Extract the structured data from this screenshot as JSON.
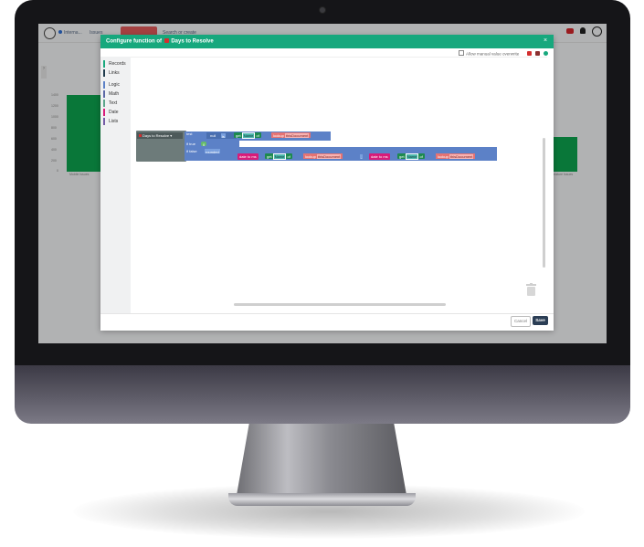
{
  "app": {
    "breadcrumbs": [
      "Interna...",
      "Issues"
    ],
    "active_tab": "",
    "search_hint": "Search or create",
    "chart": {
      "y_ticks": [
        "1400",
        "1200",
        "1000",
        "800",
        "600",
        "400",
        "200",
        "0"
      ],
      "x_labels": [
        "Mobile Issues",
        "Feature Issues"
      ]
    }
  },
  "modal": {
    "title_prefix": "Configure function of",
    "title_field": "Days to Resolve",
    "close_label": "×",
    "manual_overwrite_label": "Allow manual value overwrite",
    "toolbox": {
      "categories": [
        {
          "label": "Records",
          "color": "#17a87d"
        },
        {
          "label": "Links",
          "color": "#1f3b4d"
        },
        {
          "label": "Logic",
          "color": "#5c81c7"
        },
        {
          "label": "Math",
          "color": "#5c68a6"
        },
        {
          "label": "Text",
          "color": "#5ba58c"
        },
        {
          "label": "Date",
          "color": "#d81b79"
        },
        {
          "label": "Lists",
          "color": "#745ca6"
        }
      ]
    },
    "blocks": {
      "function_name": "Days to Resolve",
      "test_label": "test",
      "null_label": "null",
      "is_label": "is",
      "get_label": "get",
      "field_name": "Name",
      "of_label": "of",
      "lookup_label": "lookup",
      "doc_ref": "thisDocument",
      "if_true_label": "if true",
      "true_value": "0",
      "if_false_label": "if false",
      "rounded_label": "rounded",
      "date_to_ms_label": "date to ms",
      "minus_label": "-"
    },
    "buttons": {
      "cancel": "Cancel",
      "save": "Save"
    }
  },
  "colors": {
    "header": "#17a87d",
    "save": "#2b3e55",
    "chart_bar": "#0da64f"
  }
}
